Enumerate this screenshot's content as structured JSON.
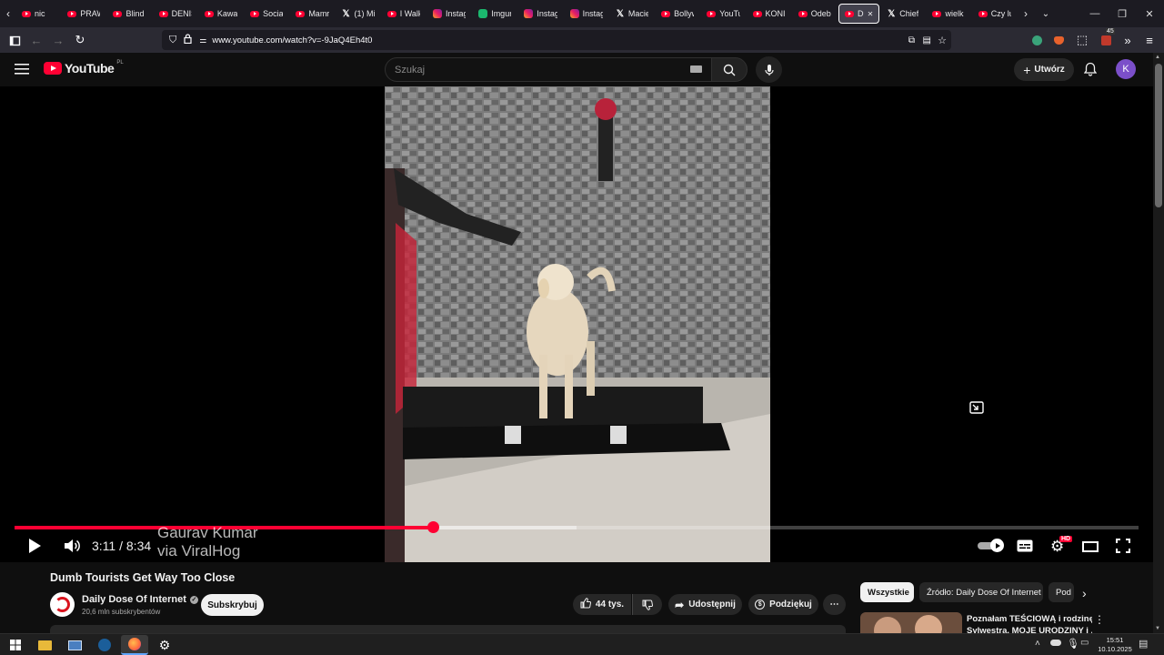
{
  "browser": {
    "tabs": [
      {
        "label": "nic",
        "fav": "yt"
      },
      {
        "label": "PRAW",
        "fav": "yt"
      },
      {
        "label": "Blind",
        "fav": "yt"
      },
      {
        "label": "DENIS",
        "fav": "yt"
      },
      {
        "label": "Kawal",
        "fav": "yt"
      },
      {
        "label": "Social",
        "fav": "yt"
      },
      {
        "label": "Mamr",
        "fav": "yt"
      },
      {
        "label": "(1) Mi",
        "fav": "x"
      },
      {
        "label": "I Walk",
        "fav": "yt"
      },
      {
        "label": "Instag",
        "fav": "ig"
      },
      {
        "label": "Imgur",
        "fav": "imgur"
      },
      {
        "label": "Instag",
        "fav": "ig"
      },
      {
        "label": "Instag",
        "fav": "ig"
      },
      {
        "label": "Macie",
        "fav": "x"
      },
      {
        "label": "Bollyw",
        "fav": "yt"
      },
      {
        "label": "YouTu",
        "fav": "yt"
      },
      {
        "label": "KONII",
        "fav": "yt"
      },
      {
        "label": "Odeb",
        "fav": "yt"
      },
      {
        "label": "Du",
        "fav": "yt",
        "active": true
      },
      {
        "label": "Chief",
        "fav": "x"
      },
      {
        "label": "wielk",
        "fav": "yt"
      },
      {
        "label": "Czy lu",
        "fav": "yt"
      }
    ],
    "url": "www.youtube.com/watch?v=-9JaQ4Eh4t0",
    "extension_badge": "45"
  },
  "youtube": {
    "logo_text": "YouTube",
    "region": "PL",
    "search_placeholder": "Szukaj",
    "create_label": "Utwórz",
    "avatar_letter": "K"
  },
  "player": {
    "current_time": "3:11",
    "duration": "8:34",
    "progress_fraction": 0.372,
    "buffered_fraction": 0.5,
    "watermark_line1": "Gaurav Kumar",
    "watermark_line2": "via ViralHog",
    "accent_color": "#ff0033",
    "settings_badge": "HD"
  },
  "video_info": {
    "title": "Dumb Tourists Get Way Too Close",
    "channel": "Daily Dose Of Internet",
    "subscribers": "20,6 mln subskrybentów",
    "subscribe_label": "Subskrybuj",
    "likes": "44 tys.",
    "share_label": "Udostępnij",
    "thanks_label": "Podziękuj"
  },
  "related": {
    "chips": [
      "Wszystkie",
      "Źródło: Daily Dose Of Internet",
      "Pod"
    ],
    "first_video_title_line1": "Poznałam TEŚCIOWĄ i rodzinę",
    "first_video_title_line2": "Sylwestra. MOJE URODZINY i ..."
  },
  "taskbar": {
    "time": "15:51",
    "date": "10.10.2025"
  }
}
